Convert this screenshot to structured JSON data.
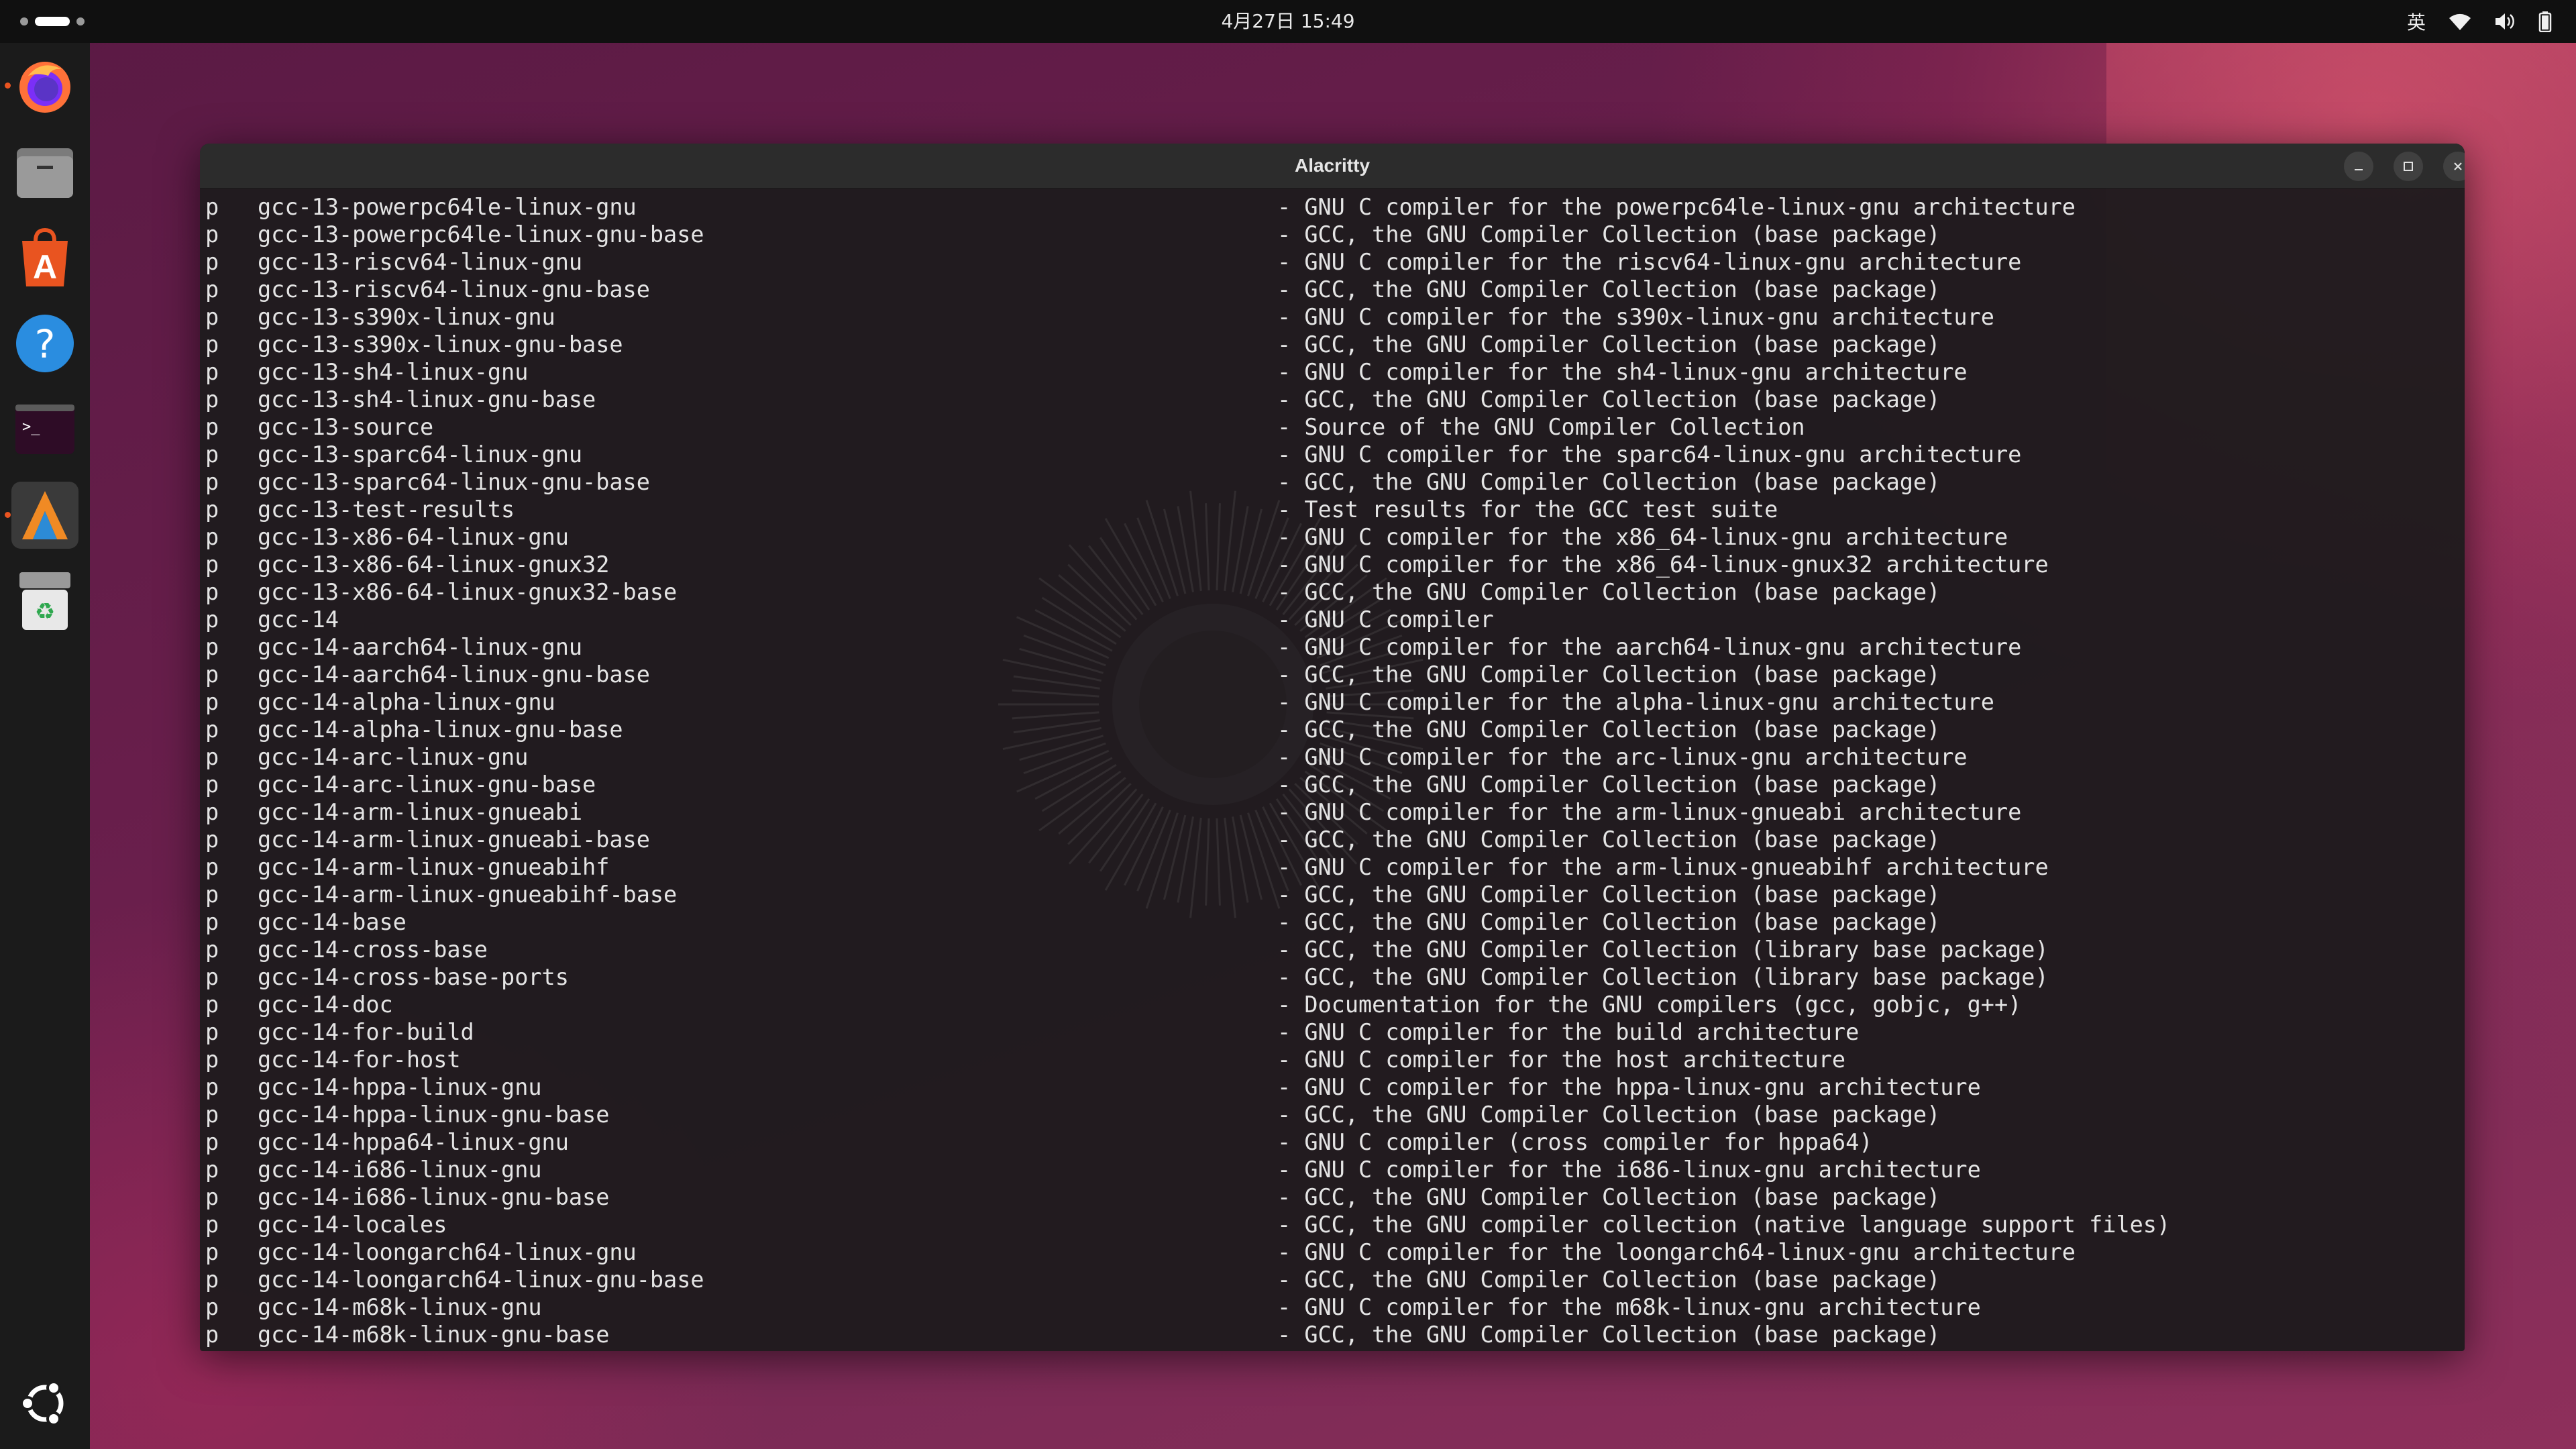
{
  "topbar": {
    "clock": "4月27日 15:49",
    "input_method": "英",
    "icons": [
      "wifi-icon",
      "volume-icon",
      "battery-icon"
    ]
  },
  "dock": {
    "items": [
      {
        "name": "firefox",
        "running": true
      },
      {
        "name": "files",
        "running": false
      },
      {
        "name": "app-center",
        "running": false
      },
      {
        "name": "help",
        "running": false
      },
      {
        "name": "terminal",
        "running": false
      },
      {
        "name": "alacritty",
        "running": true
      },
      {
        "name": "trash",
        "running": false
      }
    ],
    "show_apps": "ubuntu-logo"
  },
  "window": {
    "title": "Alacritty"
  },
  "terminal": {
    "lines": [
      {
        "status": "p",
        "pkg": "gcc-13-powerpc64le-linux-gnu",
        "desc": "- GNU C compiler for the powerpc64le-linux-gnu architecture"
      },
      {
        "status": "p",
        "pkg": "gcc-13-powerpc64le-linux-gnu-base",
        "desc": "- GCC, the GNU Compiler Collection (base package)"
      },
      {
        "status": "p",
        "pkg": "gcc-13-riscv64-linux-gnu",
        "desc": "- GNU C compiler for the riscv64-linux-gnu architecture"
      },
      {
        "status": "p",
        "pkg": "gcc-13-riscv64-linux-gnu-base",
        "desc": "- GCC, the GNU Compiler Collection (base package)"
      },
      {
        "status": "p",
        "pkg": "gcc-13-s390x-linux-gnu",
        "desc": "- GNU C compiler for the s390x-linux-gnu architecture"
      },
      {
        "status": "p",
        "pkg": "gcc-13-s390x-linux-gnu-base",
        "desc": "- GCC, the GNU Compiler Collection (base package)"
      },
      {
        "status": "p",
        "pkg": "gcc-13-sh4-linux-gnu",
        "desc": "- GNU C compiler for the sh4-linux-gnu architecture"
      },
      {
        "status": "p",
        "pkg": "gcc-13-sh4-linux-gnu-base",
        "desc": "- GCC, the GNU Compiler Collection (base package)"
      },
      {
        "status": "p",
        "pkg": "gcc-13-source",
        "desc": "- Source of the GNU Compiler Collection"
      },
      {
        "status": "p",
        "pkg": "gcc-13-sparc64-linux-gnu",
        "desc": "- GNU C compiler for the sparc64-linux-gnu architecture"
      },
      {
        "status": "p",
        "pkg": "gcc-13-sparc64-linux-gnu-base",
        "desc": "- GCC, the GNU Compiler Collection (base package)"
      },
      {
        "status": "p",
        "pkg": "gcc-13-test-results",
        "desc": "- Test results for the GCC test suite"
      },
      {
        "status": "p",
        "pkg": "gcc-13-x86-64-linux-gnu",
        "desc": "- GNU C compiler for the x86_64-linux-gnu architecture"
      },
      {
        "status": "p",
        "pkg": "gcc-13-x86-64-linux-gnux32",
        "desc": "- GNU C compiler for the x86_64-linux-gnux32 architecture"
      },
      {
        "status": "p",
        "pkg": "gcc-13-x86-64-linux-gnux32-base",
        "desc": "- GCC, the GNU Compiler Collection (base package)"
      },
      {
        "status": "p",
        "pkg": "gcc-14",
        "desc": "- GNU C compiler"
      },
      {
        "status": "p",
        "pkg": "gcc-14-aarch64-linux-gnu",
        "desc": "- GNU C compiler for the aarch64-linux-gnu architecture"
      },
      {
        "status": "p",
        "pkg": "gcc-14-aarch64-linux-gnu-base",
        "desc": "- GCC, the GNU Compiler Collection (base package)"
      },
      {
        "status": "p",
        "pkg": "gcc-14-alpha-linux-gnu",
        "desc": "- GNU C compiler for the alpha-linux-gnu architecture"
      },
      {
        "status": "p",
        "pkg": "gcc-14-alpha-linux-gnu-base",
        "desc": "- GCC, the GNU Compiler Collection (base package)"
      },
      {
        "status": "p",
        "pkg": "gcc-14-arc-linux-gnu",
        "desc": "- GNU C compiler for the arc-linux-gnu architecture"
      },
      {
        "status": "p",
        "pkg": "gcc-14-arc-linux-gnu-base",
        "desc": "- GCC, the GNU Compiler Collection (base package)"
      },
      {
        "status": "p",
        "pkg": "gcc-14-arm-linux-gnueabi",
        "desc": "- GNU C compiler for the arm-linux-gnueabi architecture"
      },
      {
        "status": "p",
        "pkg": "gcc-14-arm-linux-gnueabi-base",
        "desc": "- GCC, the GNU Compiler Collection (base package)"
      },
      {
        "status": "p",
        "pkg": "gcc-14-arm-linux-gnueabihf",
        "desc": "- GNU C compiler for the arm-linux-gnueabihf architecture"
      },
      {
        "status": "p",
        "pkg": "gcc-14-arm-linux-gnueabihf-base",
        "desc": "- GCC, the GNU Compiler Collection (base package)"
      },
      {
        "status": "p",
        "pkg": "gcc-14-base",
        "desc": "- GCC, the GNU Compiler Collection (base package)"
      },
      {
        "status": "p",
        "pkg": "gcc-14-cross-base",
        "desc": "- GCC, the GNU Compiler Collection (library base package)"
      },
      {
        "status": "p",
        "pkg": "gcc-14-cross-base-ports",
        "desc": "- GCC, the GNU Compiler Collection (library base package)"
      },
      {
        "status": "p",
        "pkg": "gcc-14-doc",
        "desc": "- Documentation for the GNU compilers (gcc, gobjc, g++)"
      },
      {
        "status": "p",
        "pkg": "gcc-14-for-build",
        "desc": "- GNU C compiler for the build architecture"
      },
      {
        "status": "p",
        "pkg": "gcc-14-for-host",
        "desc": "- GNU C compiler for the host architecture"
      },
      {
        "status": "p",
        "pkg": "gcc-14-hppa-linux-gnu",
        "desc": "- GNU C compiler for the hppa-linux-gnu architecture"
      },
      {
        "status": "p",
        "pkg": "gcc-14-hppa-linux-gnu-base",
        "desc": "- GCC, the GNU Compiler Collection (base package)"
      },
      {
        "status": "p",
        "pkg": "gcc-14-hppa64-linux-gnu",
        "desc": "- GNU C compiler (cross compiler for hppa64)"
      },
      {
        "status": "p",
        "pkg": "gcc-14-i686-linux-gnu",
        "desc": "- GNU C compiler for the i686-linux-gnu architecture"
      },
      {
        "status": "p",
        "pkg": "gcc-14-i686-linux-gnu-base",
        "desc": "- GCC, the GNU Compiler Collection (base package)"
      },
      {
        "status": "p",
        "pkg": "gcc-14-locales",
        "desc": "- GCC, the GNU compiler collection (native language support files)"
      },
      {
        "status": "p",
        "pkg": "gcc-14-loongarch64-linux-gnu",
        "desc": "- GNU C compiler for the loongarch64-linux-gnu architecture"
      },
      {
        "status": "p",
        "pkg": "gcc-14-loongarch64-linux-gnu-base",
        "desc": "- GCC, the GNU Compiler Collection (base package)"
      },
      {
        "status": "p",
        "pkg": "gcc-14-m68k-linux-gnu",
        "desc": "- GNU C compiler for the m68k-linux-gnu architecture"
      },
      {
        "status": "p",
        "pkg": "gcc-14-m68k-linux-gnu-base",
        "desc": "- GCC, the GNU Compiler Collection (base package)"
      }
    ]
  },
  "colors": {
    "accent": "#e95420",
    "terminal_bg": "#1e1b1d",
    "terminal_fg": "#e4e4e4",
    "topbar_bg": "#101010",
    "dock_bg": "#1b1b1b"
  }
}
